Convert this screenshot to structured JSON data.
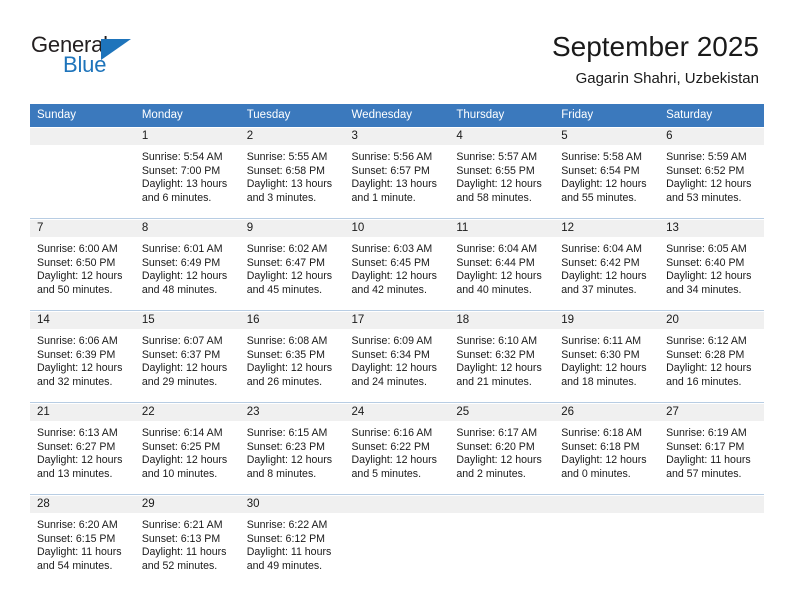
{
  "brand": {
    "name_part1": "General",
    "name_part2": "Blue",
    "triangle_color": "#1e74bb"
  },
  "header": {
    "title": "September 2025",
    "subtitle": "Gagarin Shahri, Uzbekistan",
    "header_bg_color": "#3b79bd",
    "daynum_bg_color": "#f0f0f0"
  },
  "weekdays": [
    "Sunday",
    "Monday",
    "Tuesday",
    "Wednesday",
    "Thursday",
    "Friday",
    "Saturday"
  ],
  "weeks": [
    [
      {
        "day": ""
      },
      {
        "day": "1",
        "sunrise": "Sunrise: 5:54 AM",
        "sunset": "Sunset: 7:00 PM",
        "daylight_line1": "Daylight: 13 hours",
        "daylight_line2": "and 6 minutes."
      },
      {
        "day": "2",
        "sunrise": "Sunrise: 5:55 AM",
        "sunset": "Sunset: 6:58 PM",
        "daylight_line1": "Daylight: 13 hours",
        "daylight_line2": "and 3 minutes."
      },
      {
        "day": "3",
        "sunrise": "Sunrise: 5:56 AM",
        "sunset": "Sunset: 6:57 PM",
        "daylight_line1": "Daylight: 13 hours",
        "daylight_line2": "and 1 minute."
      },
      {
        "day": "4",
        "sunrise": "Sunrise: 5:57 AM",
        "sunset": "Sunset: 6:55 PM",
        "daylight_line1": "Daylight: 12 hours",
        "daylight_line2": "and 58 minutes."
      },
      {
        "day": "5",
        "sunrise": "Sunrise: 5:58 AM",
        "sunset": "Sunset: 6:54 PM",
        "daylight_line1": "Daylight: 12 hours",
        "daylight_line2": "and 55 minutes."
      },
      {
        "day": "6",
        "sunrise": "Sunrise: 5:59 AM",
        "sunset": "Sunset: 6:52 PM",
        "daylight_line1": "Daylight: 12 hours",
        "daylight_line2": "and 53 minutes."
      }
    ],
    [
      {
        "day": "7",
        "sunrise": "Sunrise: 6:00 AM",
        "sunset": "Sunset: 6:50 PM",
        "daylight_line1": "Daylight: 12 hours",
        "daylight_line2": "and 50 minutes."
      },
      {
        "day": "8",
        "sunrise": "Sunrise: 6:01 AM",
        "sunset": "Sunset: 6:49 PM",
        "daylight_line1": "Daylight: 12 hours",
        "daylight_line2": "and 48 minutes."
      },
      {
        "day": "9",
        "sunrise": "Sunrise: 6:02 AM",
        "sunset": "Sunset: 6:47 PM",
        "daylight_line1": "Daylight: 12 hours",
        "daylight_line2": "and 45 minutes."
      },
      {
        "day": "10",
        "sunrise": "Sunrise: 6:03 AM",
        "sunset": "Sunset: 6:45 PM",
        "daylight_line1": "Daylight: 12 hours",
        "daylight_line2": "and 42 minutes."
      },
      {
        "day": "11",
        "sunrise": "Sunrise: 6:04 AM",
        "sunset": "Sunset: 6:44 PM",
        "daylight_line1": "Daylight: 12 hours",
        "daylight_line2": "and 40 minutes."
      },
      {
        "day": "12",
        "sunrise": "Sunrise: 6:04 AM",
        "sunset": "Sunset: 6:42 PM",
        "daylight_line1": "Daylight: 12 hours",
        "daylight_line2": "and 37 minutes."
      },
      {
        "day": "13",
        "sunrise": "Sunrise: 6:05 AM",
        "sunset": "Sunset: 6:40 PM",
        "daylight_line1": "Daylight: 12 hours",
        "daylight_line2": "and 34 minutes."
      }
    ],
    [
      {
        "day": "14",
        "sunrise": "Sunrise: 6:06 AM",
        "sunset": "Sunset: 6:39 PM",
        "daylight_line1": "Daylight: 12 hours",
        "daylight_line2": "and 32 minutes."
      },
      {
        "day": "15",
        "sunrise": "Sunrise: 6:07 AM",
        "sunset": "Sunset: 6:37 PM",
        "daylight_line1": "Daylight: 12 hours",
        "daylight_line2": "and 29 minutes."
      },
      {
        "day": "16",
        "sunrise": "Sunrise: 6:08 AM",
        "sunset": "Sunset: 6:35 PM",
        "daylight_line1": "Daylight: 12 hours",
        "daylight_line2": "and 26 minutes."
      },
      {
        "day": "17",
        "sunrise": "Sunrise: 6:09 AM",
        "sunset": "Sunset: 6:34 PM",
        "daylight_line1": "Daylight: 12 hours",
        "daylight_line2": "and 24 minutes."
      },
      {
        "day": "18",
        "sunrise": "Sunrise: 6:10 AM",
        "sunset": "Sunset: 6:32 PM",
        "daylight_line1": "Daylight: 12 hours",
        "daylight_line2": "and 21 minutes."
      },
      {
        "day": "19",
        "sunrise": "Sunrise: 6:11 AM",
        "sunset": "Sunset: 6:30 PM",
        "daylight_line1": "Daylight: 12 hours",
        "daylight_line2": "and 18 minutes."
      },
      {
        "day": "20",
        "sunrise": "Sunrise: 6:12 AM",
        "sunset": "Sunset: 6:28 PM",
        "daylight_line1": "Daylight: 12 hours",
        "daylight_line2": "and 16 minutes."
      }
    ],
    [
      {
        "day": "21",
        "sunrise": "Sunrise: 6:13 AM",
        "sunset": "Sunset: 6:27 PM",
        "daylight_line1": "Daylight: 12 hours",
        "daylight_line2": "and 13 minutes."
      },
      {
        "day": "22",
        "sunrise": "Sunrise: 6:14 AM",
        "sunset": "Sunset: 6:25 PM",
        "daylight_line1": "Daylight: 12 hours",
        "daylight_line2": "and 10 minutes."
      },
      {
        "day": "23",
        "sunrise": "Sunrise: 6:15 AM",
        "sunset": "Sunset: 6:23 PM",
        "daylight_line1": "Daylight: 12 hours",
        "daylight_line2": "and 8 minutes."
      },
      {
        "day": "24",
        "sunrise": "Sunrise: 6:16 AM",
        "sunset": "Sunset: 6:22 PM",
        "daylight_line1": "Daylight: 12 hours",
        "daylight_line2": "and 5 minutes."
      },
      {
        "day": "25",
        "sunrise": "Sunrise: 6:17 AM",
        "sunset": "Sunset: 6:20 PM",
        "daylight_line1": "Daylight: 12 hours",
        "daylight_line2": "and 2 minutes."
      },
      {
        "day": "26",
        "sunrise": "Sunrise: 6:18 AM",
        "sunset": "Sunset: 6:18 PM",
        "daylight_line1": "Daylight: 12 hours",
        "daylight_line2": "and 0 minutes."
      },
      {
        "day": "27",
        "sunrise": "Sunrise: 6:19 AM",
        "sunset": "Sunset: 6:17 PM",
        "daylight_line1": "Daylight: 11 hours",
        "daylight_line2": "and 57 minutes."
      }
    ],
    [
      {
        "day": "28",
        "sunrise": "Sunrise: 6:20 AM",
        "sunset": "Sunset: 6:15 PM",
        "daylight_line1": "Daylight: 11 hours",
        "daylight_line2": "and 54 minutes."
      },
      {
        "day": "29",
        "sunrise": "Sunrise: 6:21 AM",
        "sunset": "Sunset: 6:13 PM",
        "daylight_line1": "Daylight: 11 hours",
        "daylight_line2": "and 52 minutes."
      },
      {
        "day": "30",
        "sunrise": "Sunrise: 6:22 AM",
        "sunset": "Sunset: 6:12 PM",
        "daylight_line1": "Daylight: 11 hours",
        "daylight_line2": "and 49 minutes."
      },
      {
        "day": ""
      },
      {
        "day": ""
      },
      {
        "day": ""
      },
      {
        "day": ""
      }
    ]
  ]
}
